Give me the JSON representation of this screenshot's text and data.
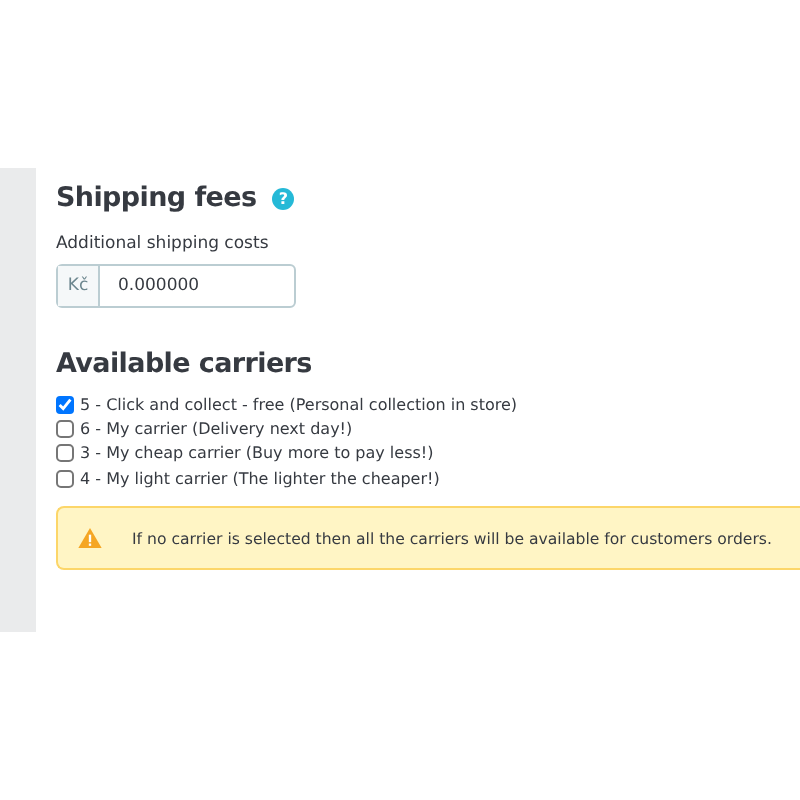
{
  "shipping_fees": {
    "title": "Shipping fees",
    "help": "?",
    "label": "Additional shipping costs",
    "currency": "Kč",
    "value": "0.000000"
  },
  "carriers": {
    "title": "Available carriers",
    "items": [
      {
        "label": "5 - Click and collect - free (Personal collection in store)",
        "checked": true
      },
      {
        "label": "6 - My carrier (Delivery next day!)",
        "checked": false
      },
      {
        "label": "3 - My cheap carrier (Buy more to pay less!)",
        "checked": false
      },
      {
        "label": "4 - My light carrier (The lighter the cheaper!)",
        "checked": false
      }
    ]
  },
  "alert": {
    "text": "If no carrier is selected then all the carriers will be available for customers orders."
  }
}
